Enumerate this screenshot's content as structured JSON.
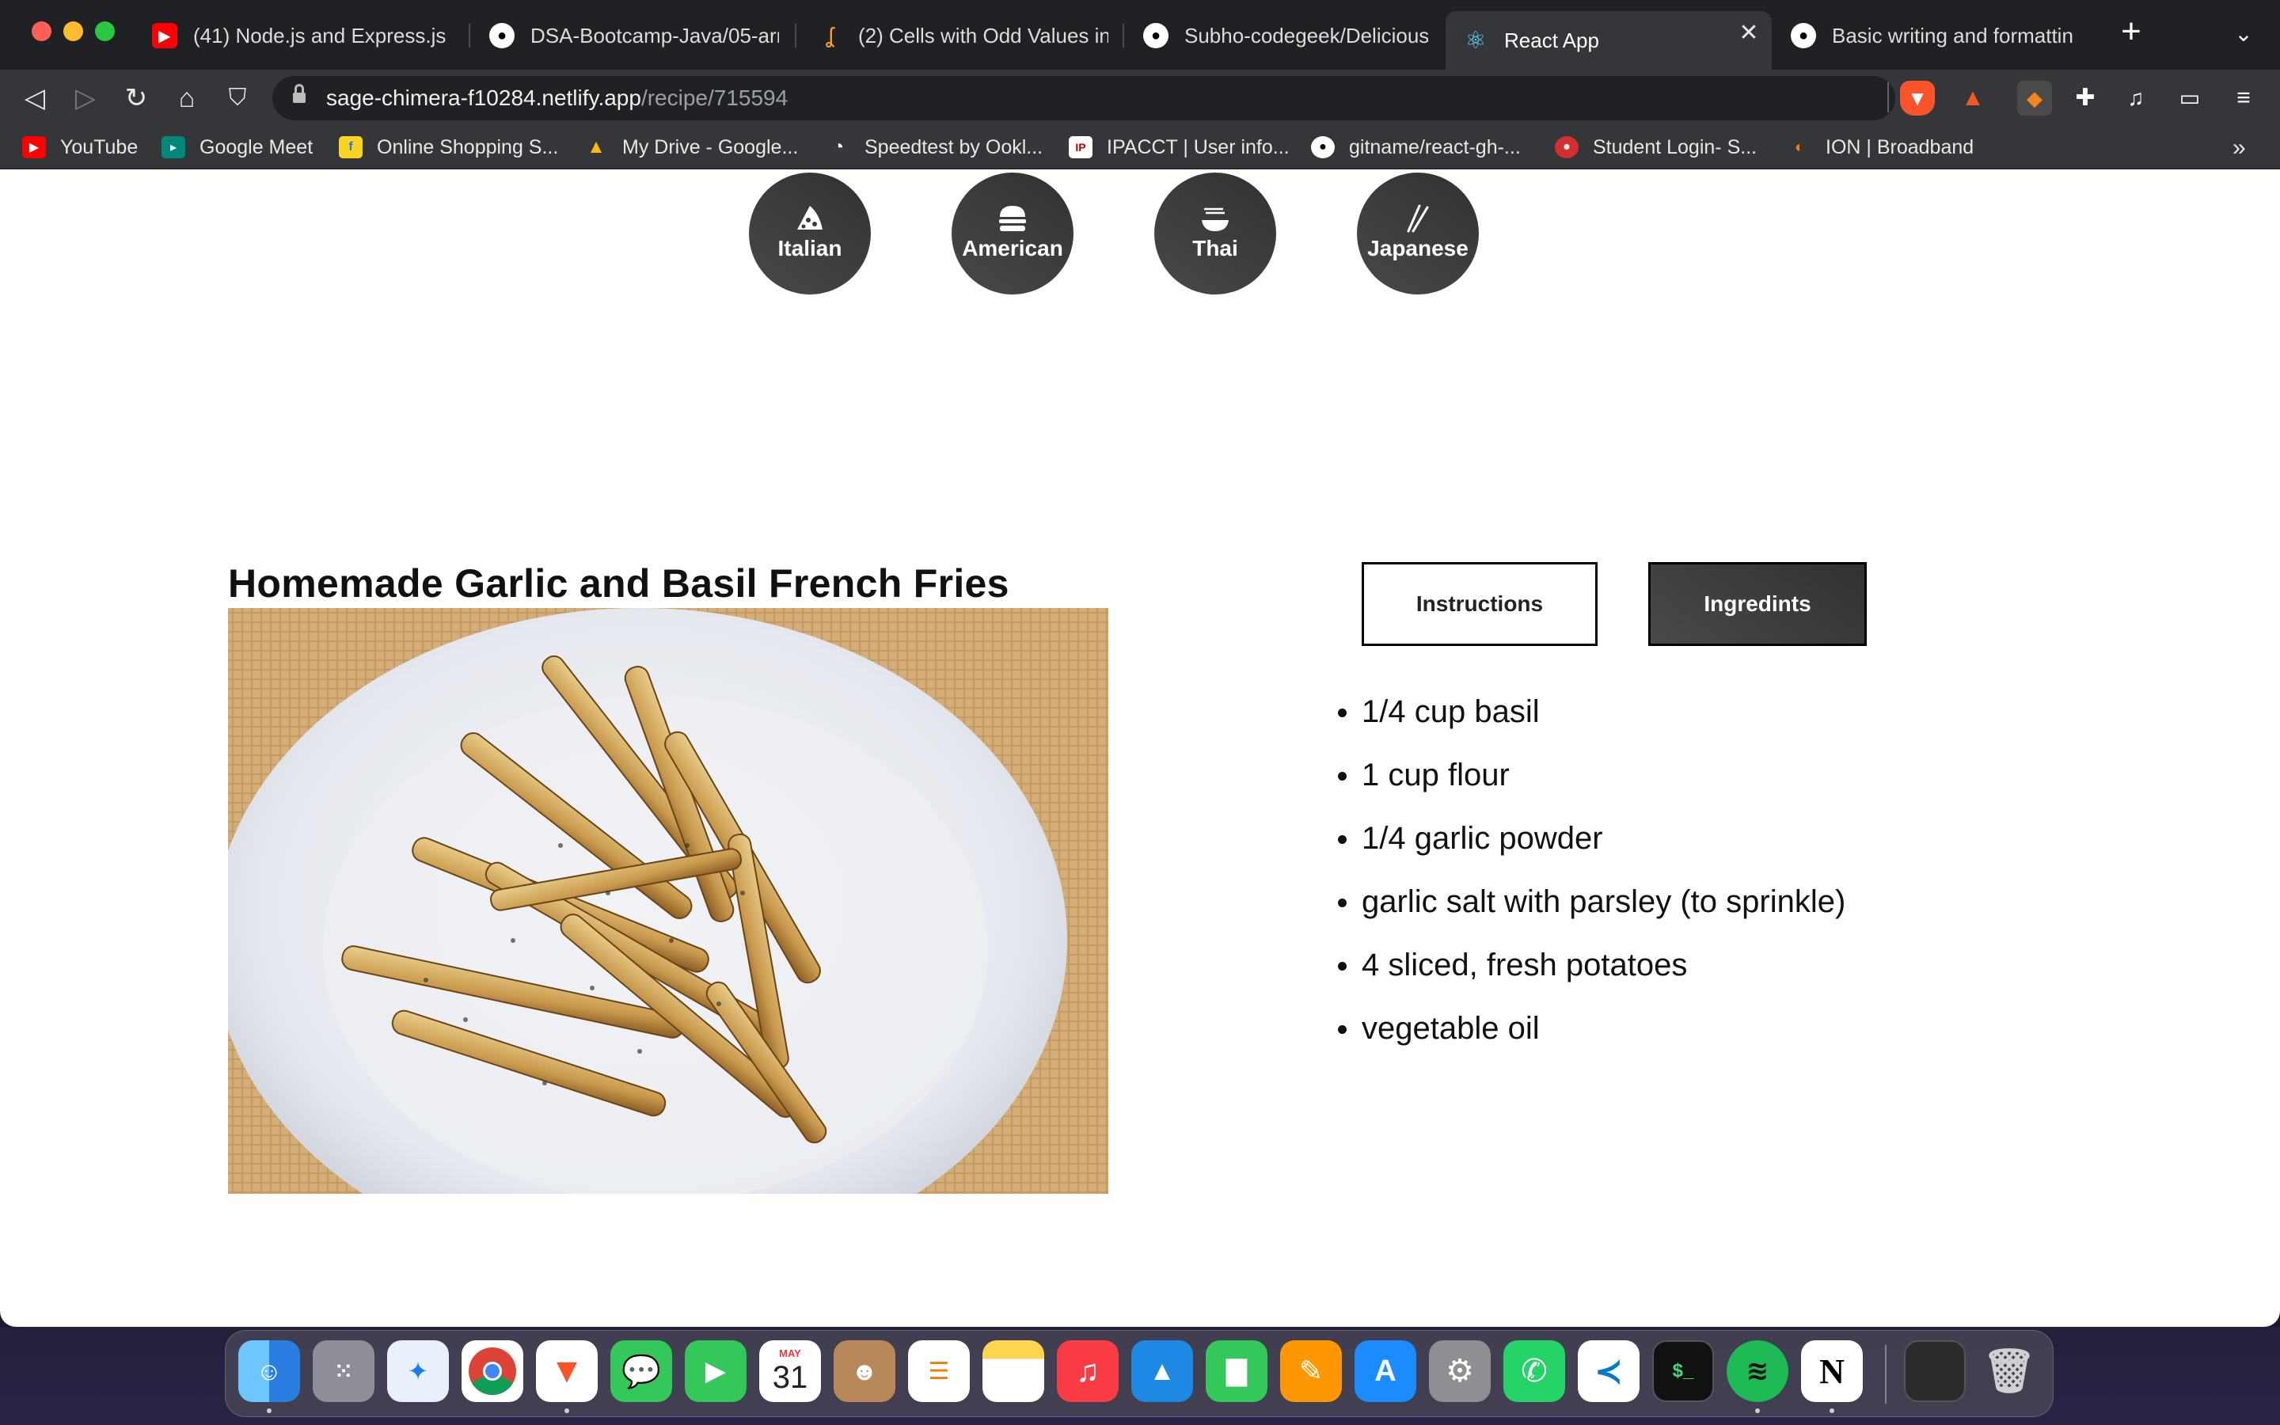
{
  "browser": {
    "tabs": [
      {
        "title": "(41) Node.js and Express.js - F",
        "icon": "youtube-icon"
      },
      {
        "title": "DSA-Bootcamp-Java/05-array",
        "icon": "github-icon"
      },
      {
        "title": "(2) Cells with Odd Values in a",
        "icon": "leetcode-icon"
      },
      {
        "title": "Subho-codegeek/Delicious-R",
        "icon": "github-icon"
      },
      {
        "title": "React App",
        "icon": "react-icon"
      },
      {
        "title": "Basic writing and formatting s",
        "icon": "github-icon"
      }
    ],
    "close_glyph": "✕",
    "new_tab_glyph": "+",
    "url_host": "sage-chimera-f10284.netlify.app",
    "url_path": "/recipe/715594",
    "bookmarks": [
      {
        "label": "YouTube",
        "icon": "youtube-icon"
      },
      {
        "label": "Google Meet",
        "icon": "google-meet-icon"
      },
      {
        "label": "Online Shopping S...",
        "icon": "flipkart-icon"
      },
      {
        "label": "My Drive - Google...",
        "icon": "google-drive-icon"
      },
      {
        "label": "Speedtest by Ookl...",
        "icon": "speedtest-icon"
      },
      {
        "label": "IPACCT | User info...",
        "icon": "ipacct-icon"
      },
      {
        "label": "gitname/react-gh-...",
        "icon": "github-icon"
      },
      {
        "label": "Student Login- S...",
        "icon": "student-login-icon"
      },
      {
        "label": "ION | Broadband",
        "icon": "ion-broadband-icon"
      }
    ],
    "bookmarks_more": "»"
  },
  "page": {
    "cuisines": [
      {
        "label": "Italian",
        "icon": "pizza-icon"
      },
      {
        "label": "American",
        "icon": "burger-icon"
      },
      {
        "label": "Thai",
        "icon": "noodle-bowl-icon"
      },
      {
        "label": "Japanese",
        "icon": "chopsticks-icon"
      }
    ],
    "recipe_title": "Homemade Garlic and Basil French Fries",
    "tabs": {
      "instructions": "Instructions",
      "ingredients": "Ingredints",
      "active": "ingredients"
    },
    "ingredients": [
      "1/4 cup basil",
      "1 cup flour",
      "1/4 garlic powder",
      "garlic salt with parsley (to sprinkle)",
      "4 sliced, fresh potatoes",
      "vegetable oil"
    ],
    "colors": {
      "button_dark": "#313131",
      "text": "#111111"
    }
  },
  "dock": {
    "calendar_month": "MAY",
    "calendar_day": "31"
  }
}
